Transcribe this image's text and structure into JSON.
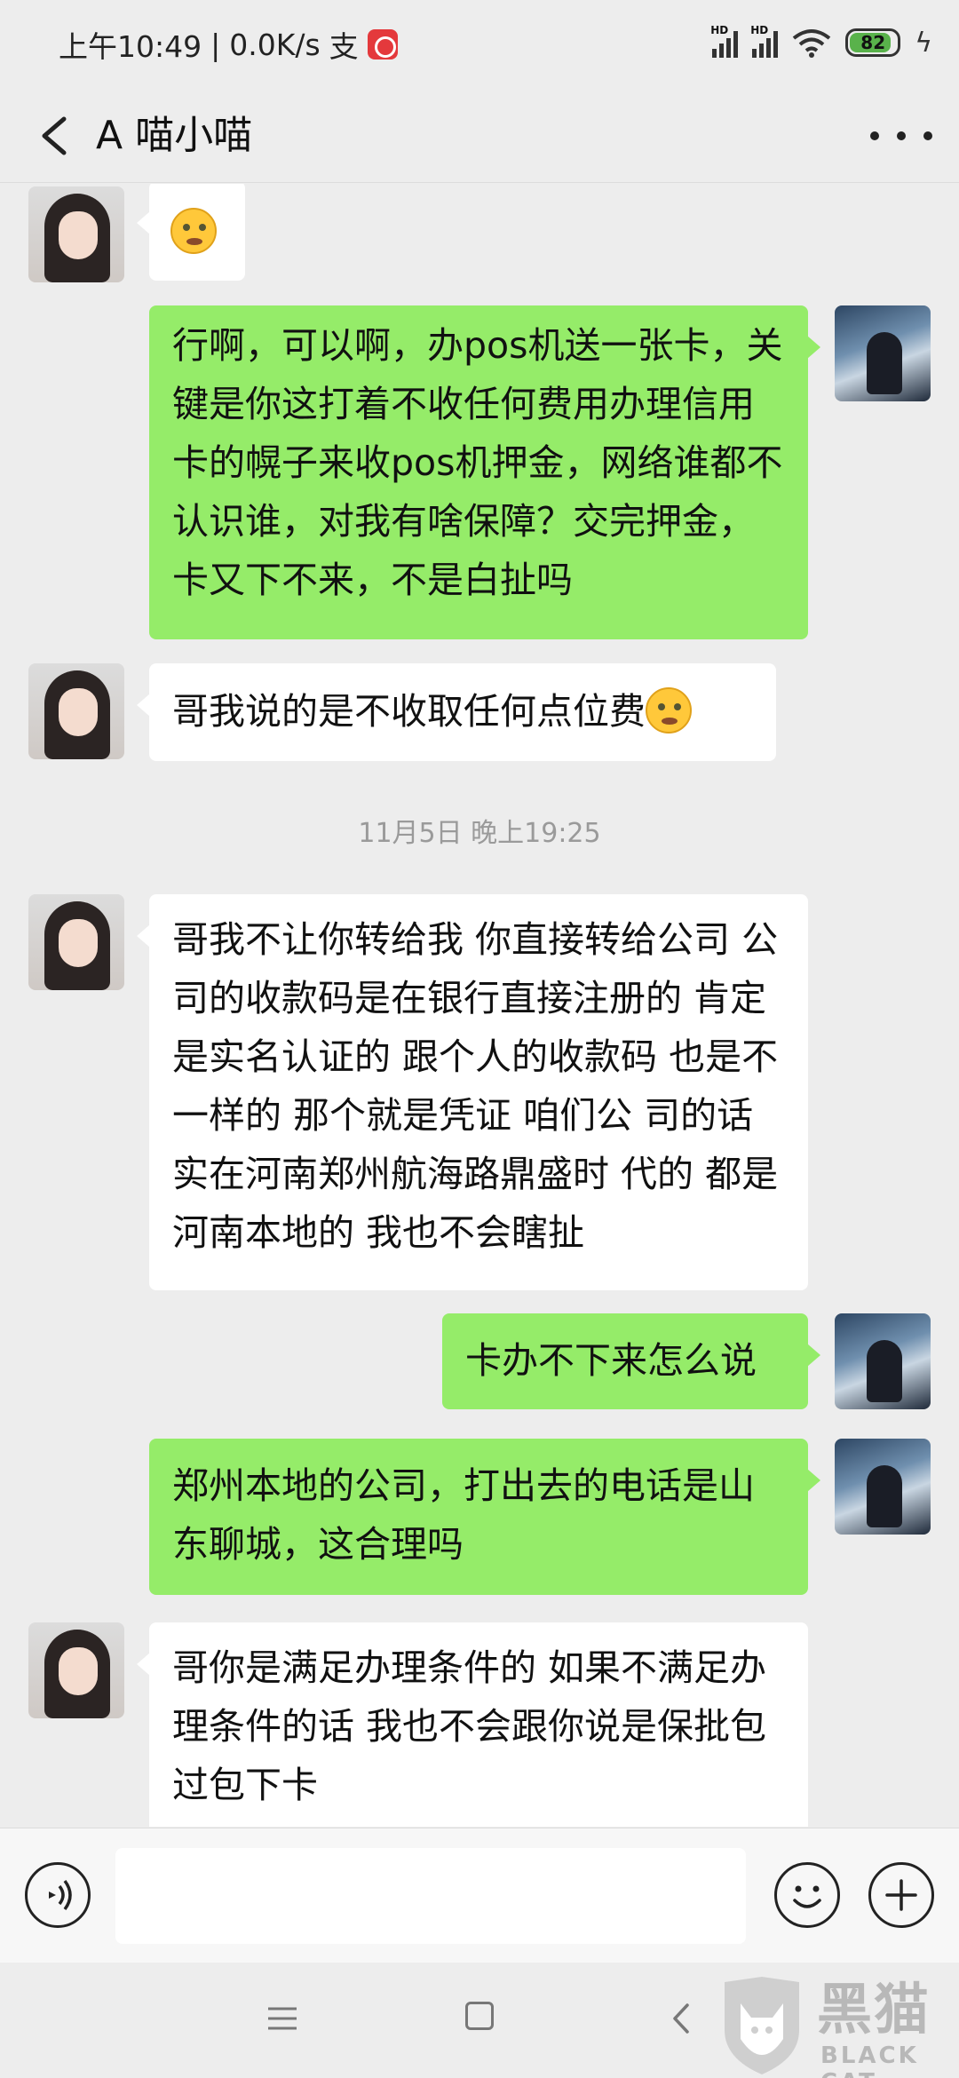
{
  "status_bar": {
    "time": "上午10:49",
    "network_speed": "0.0K/s",
    "pay_glyph": "支",
    "signal_1": "HD",
    "signal_2": "HD",
    "battery": "82",
    "charging_icon": "bolt-icon"
  },
  "header": {
    "title": "A 喵小喵",
    "back_icon": "chevron-left-icon",
    "more_icon": "more-dots-icon"
  },
  "messages": [
    {
      "side": "in",
      "text": "",
      "emoji": "dizzy-face"
    },
    {
      "side": "out",
      "text": "行啊，可以啊，办pos机送一张卡，关键是你这打着不收任何费用办理信用卡的幌子来收pos机押金，网络谁都不认识谁，对我有啥保障？交完押金，卡又下不来，不是白扯吗"
    },
    {
      "side": "in",
      "text": "哥我说的是不收取任何点位费"
    },
    {
      "side": "in",
      "text": "哥我不让你转给我 你直接转给公司 公司的收款码是在银行直接注册的 肯定是实名认证的 跟个人的收款码 也是不一样的 那个就是凭证 咱们公 司的话实在河南郑州航海路鼎盛时 代的 都是河南本地的 我也不会瞎扯"
    },
    {
      "side": "out",
      "text": "卡办不下来怎么说"
    },
    {
      "side": "out",
      "text": "郑州本地的公司，打出去的电话是山东聊城，这合理吗"
    },
    {
      "side": "in",
      "text": "哥你是满足办理条件的 如果不满足办理条件的话 我也不会跟你说是保批包过包下卡"
    }
  ],
  "timestamp": "11月5日 晚上19:25",
  "input_bar": {
    "placeholder": "",
    "voice_icon": "voice-icon",
    "emoji_icon": "emoji-icon",
    "plus_icon": "plus-icon"
  },
  "nav_bar": {
    "menu_icon": "menu-icon",
    "home_icon": "home-icon",
    "back_icon": "back-icon"
  },
  "watermark": {
    "cn": "黑猫",
    "en": "BLACK CAT"
  },
  "colors": {
    "bubble_out": "#95ec69",
    "bubble_in": "#ffffff",
    "background": "#ededed"
  }
}
